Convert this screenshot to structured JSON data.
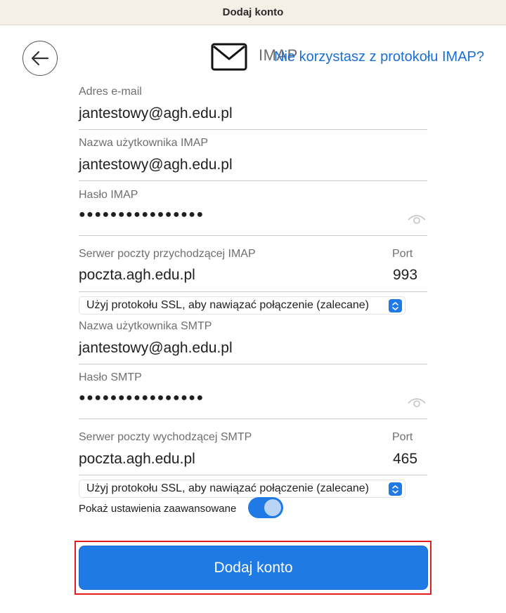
{
  "window": {
    "title": "Dodaj konto"
  },
  "header": {
    "protocol_label": "IMAP",
    "not_imap_link": "Nie korzystasz z protokołu IMAP?"
  },
  "fields": {
    "email": {
      "label": "Adres e-mail",
      "value": "jantestowy@agh.edu.pl"
    },
    "imap_user": {
      "label": "Nazwa użytkownika IMAP",
      "value": "jantestowy@agh.edu.pl"
    },
    "imap_password": {
      "label": "Hasło IMAP",
      "value": "●●●●●●●●●●●●●●●●"
    },
    "imap_server": {
      "label": "Serwer poczty przychodzącej IMAP",
      "value": "poczta.agh.edu.pl",
      "port_label": "Port",
      "port_value": "993"
    },
    "imap_ssl": {
      "selected": "Użyj protokołu SSL, aby nawiązać połączenie (zalecane)"
    },
    "smtp_user": {
      "label": "Nazwa użytkownika SMTP",
      "value": "jantestowy@agh.edu.pl"
    },
    "smtp_password": {
      "label": "Hasło SMTP",
      "value": "●●●●●●●●●●●●●●●●"
    },
    "smtp_server": {
      "label": "Serwer poczty wychodzącej SMTP",
      "value": "poczta.agh.edu.pl",
      "port_label": "Port",
      "port_value": "465"
    },
    "smtp_ssl": {
      "selected": "Użyj protokołu SSL, aby nawiązać połączenie (zalecane)"
    }
  },
  "advanced": {
    "label": "Pokaż ustawienia zaawansowane",
    "enabled": true
  },
  "actions": {
    "add_account": "Dodaj konto"
  },
  "colors": {
    "accent": "#1f7ae6",
    "highlight": "#e01c1c",
    "titlebar": "#f6efe7"
  },
  "icons": {
    "back": "arrow-left-icon",
    "mail": "envelope-icon",
    "eye": "eye-icon",
    "stepper": "chevron-updown-icon"
  }
}
